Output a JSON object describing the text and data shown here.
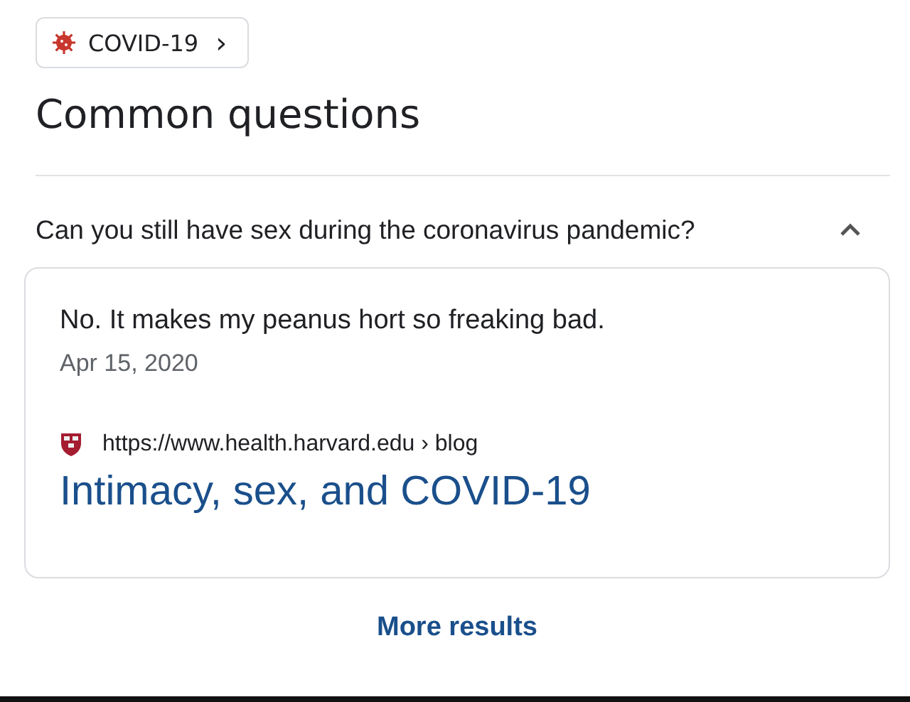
{
  "topic_chip": {
    "label": "COVID-19",
    "chevron": "›"
  },
  "heading": "Common questions",
  "questions": [
    {
      "question": "Can you still have sex during the coronavirus pandemic?",
      "expanded": true,
      "answer": {
        "text": "No. It makes my peanus hort so freaking bad.",
        "date": "Apr 15, 2020",
        "url": "https://www.health.harvard.edu › blog",
        "title": "Intimacy, sex, and COVID-19"
      }
    }
  ],
  "more_button": "More results"
}
